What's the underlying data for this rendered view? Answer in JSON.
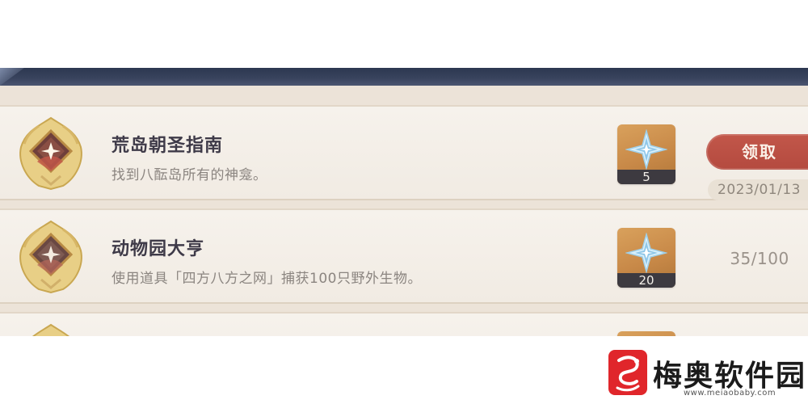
{
  "achievements": [
    {
      "title": "荒岛朝圣指南",
      "description": "找到八酝岛所有的神龛。",
      "reward_count": "5",
      "claim_label": "领取",
      "date": "2023/01/13"
    },
    {
      "title": "动物园大亨",
      "description": "使用道具「四方八方之网」捕获100只野外生物。",
      "reward_count": "20",
      "progress": "35/100"
    }
  ],
  "colors": {
    "claim_button": "#b9503f",
    "reward_tile": "#c88948",
    "top_bar": "#333d56"
  },
  "icons": {
    "badge": "achievement-badge-icon",
    "reward": "primogem-icon",
    "watermark": "dragon-logo-icon"
  },
  "watermark": {
    "name": "梅奥软件园",
    "url": "www.meiaobaby.com"
  }
}
